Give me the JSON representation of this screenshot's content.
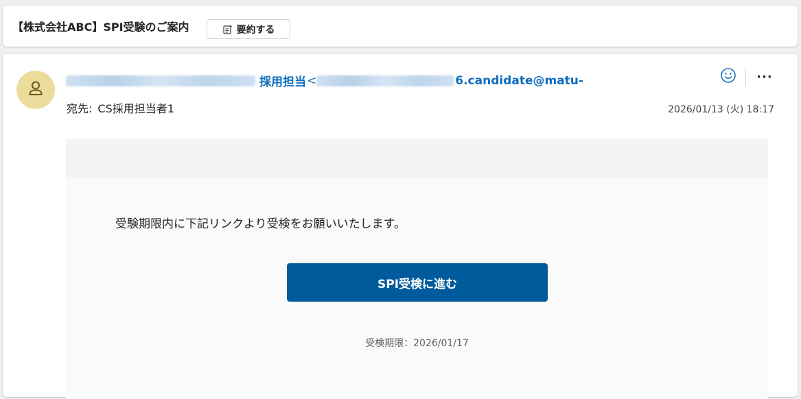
{
  "subject": {
    "title": "【株式会社ABC】SPI受験のご案内",
    "summarize_label": "要約する"
  },
  "message": {
    "sender_role": "採用担当",
    "sender_lt": "<",
    "sender_email_visible": "6.candidate@matu-",
    "to_label": "宛先:",
    "to_value": "CS採用担当者1",
    "date": "2026/01/13 (火) 18:17",
    "more_label": "···"
  },
  "body": {
    "instruction": "受験期限内に下記リンクより受検をお願いいたします。",
    "cta_label": "SPI受検に進む",
    "deadline": "受検期限：2026/01/17"
  },
  "icons": {
    "summarize": "summarize-icon",
    "avatar": "person-icon",
    "emoji": "smiley-icon",
    "more": "more-icon"
  },
  "colors": {
    "link": "#0f6cbd",
    "avatar_bg": "#ecdc9c",
    "cta_bg": "#005a9c"
  }
}
